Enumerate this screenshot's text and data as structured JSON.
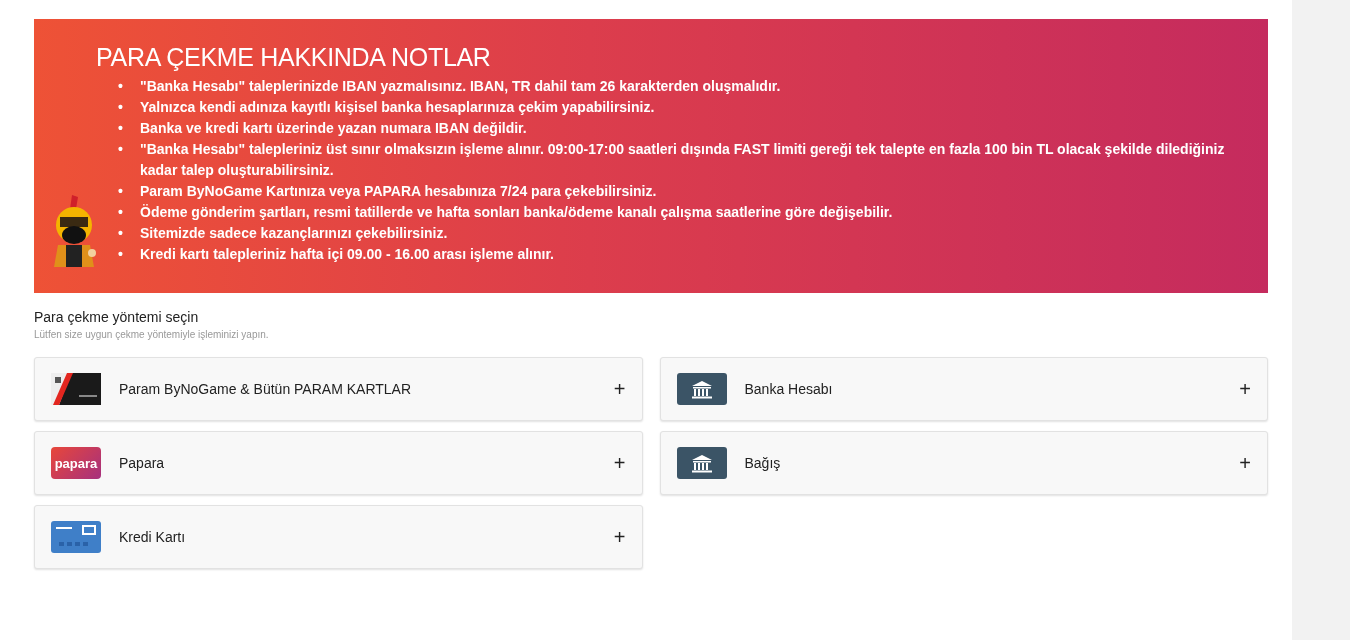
{
  "notes": {
    "title": "PARA ÇEKME HAKKINDA NOTLAR",
    "bullet": "•",
    "items": [
      "\"Banka Hesabı\" taleplerinizde IBAN yazmalısınız. IBAN, TR dahil tam 26 karakterden oluşmalıdır.",
      "Yalnızca kendi adınıza kayıtlı kişisel banka hesaplarınıza çekim yapabilirsiniz.",
      "Banka ve kredi kartı üzerinde yazan numara IBAN değildir.",
      "\"Banka Hesabı\" talepleriniz üst sınır olmaksızın işleme alınır. 09:00-17:00 saatleri dışında FAST limiti gereği tek talepte en fazla 100 bin TL olacak şekilde dilediğiniz kadar talep oluşturabilirsiniz.",
      "Param ByNoGame Kartınıza veya PAPARA hesabınıza 7/24 para çekebilirsiniz.",
      "Ödeme gönderim şartları, resmi tatillerde ve hafta sonları banka/ödeme kanalı çalışma saatlerine göre değişebilir.",
      "Sitemizde sadece kazançlarınızı çekebilirsiniz.",
      "Kredi kartı talepleriniz hafta içi 09.00 - 16.00 arası işleme alınır."
    ]
  },
  "methods_section": {
    "title": "Para çekme yöntemi seçin",
    "subtitle": "Lütfen size uygun çekme yöntemiyle işleminizi yapın.",
    "methods": [
      {
        "kind": "card",
        "label": "Param ByNoGame & Bütün PARAM KARTLAR",
        "expand": "+"
      },
      {
        "kind": "bank",
        "label": "Banka Hesabı",
        "expand": "+"
      },
      {
        "kind": "papara",
        "logo": "papara",
        "label": "Papara",
        "expand": "+"
      },
      {
        "kind": "bank",
        "label": "Bağış",
        "expand": "+"
      },
      {
        "kind": "credit",
        "label": "Kredi Kartı",
        "expand": "+"
      }
    ]
  }
}
